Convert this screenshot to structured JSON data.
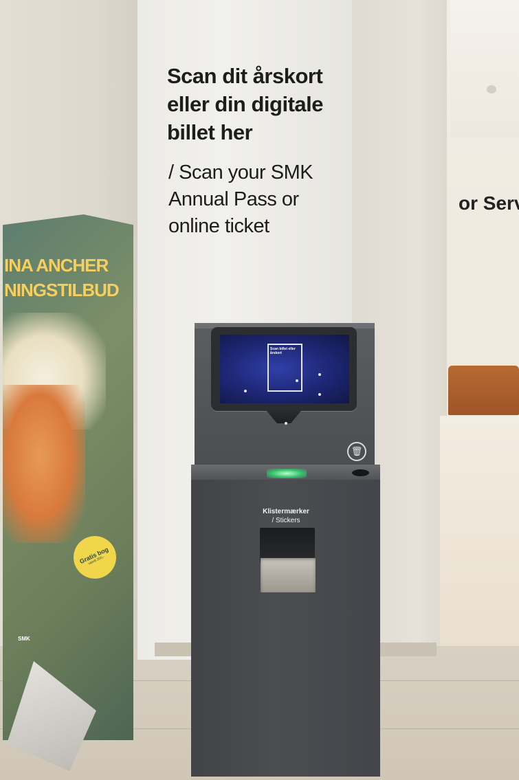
{
  "pillar_sign": {
    "danish_lines": [
      "Scan dit årskort",
      "eller din digitale",
      "billet her"
    ],
    "english_lines": [
      "/ Scan your SMK",
      "Annual Pass or",
      "online ticket"
    ]
  },
  "kiosk": {
    "screen": {
      "card_title": "Scan billet eller årskort"
    },
    "sticker_label_da": "Klistermærker",
    "sticker_label_en": "/ Stickers",
    "bin_icon": "trash-icon"
  },
  "poster": {
    "title_lines": [
      "INA ANCHER",
      "NINGSTILBUD"
    ],
    "badge_main": "Gratis bog",
    "badge_sub": "værdi 200,-",
    "brand": "SMK"
  },
  "room": {
    "sign_text": "or Serv"
  },
  "colors": {
    "kiosk_body": "#45474b",
    "screen_blue": "#1d2673",
    "scanner_green": "#36c06a",
    "poster_yellow": "#f5d060"
  }
}
